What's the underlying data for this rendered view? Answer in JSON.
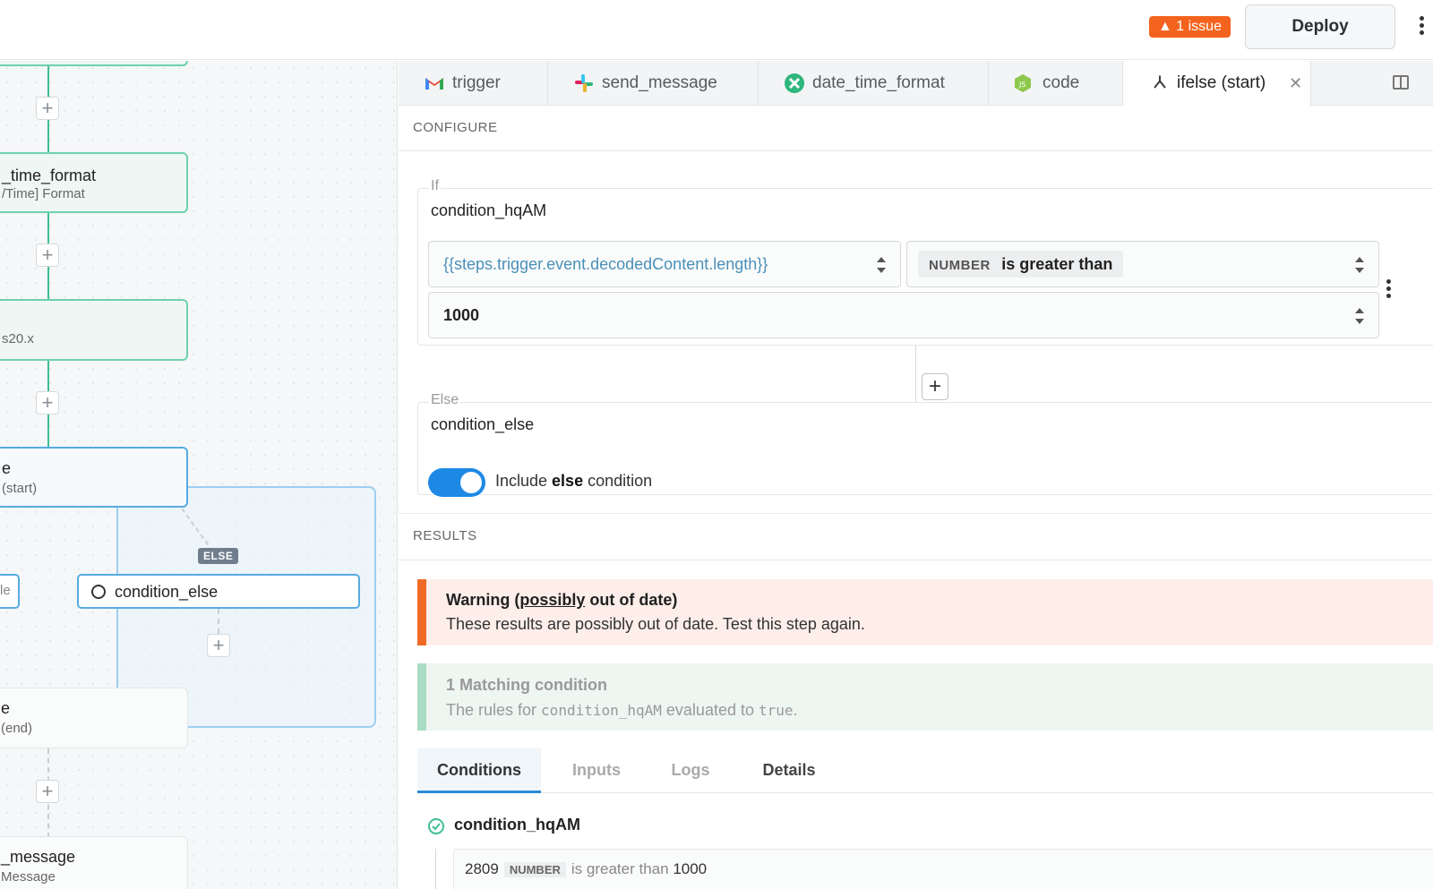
{
  "header": {
    "issue_badge": "▲ 1 issue",
    "deploy_label": "Deploy"
  },
  "canvas": {
    "node_date_time_format": {
      "title": "_time_format",
      "subtitle": "/Time] Format"
    },
    "node_code": {
      "subtitle": "s20.x"
    },
    "node_ifelse_start": {
      "title": "e",
      "subtitle": "(start)"
    },
    "else_tag": "ELSE",
    "node_if_partial": "le",
    "node_condition_else": "condition_else",
    "node_ifelse_end": {
      "title": "e",
      "subtitle": "(end)"
    },
    "node_send_message": {
      "title": "_message",
      "subtitle": "Message"
    }
  },
  "tabs": [
    {
      "label": "trigger",
      "icon": "gmail-icon"
    },
    {
      "label": "send_message",
      "icon": "slack-icon"
    },
    {
      "label": "date_time_format",
      "icon": "tools-icon"
    },
    {
      "label": "code",
      "icon": "nodejs-icon"
    },
    {
      "label": "ifelse (start)",
      "icon": "branch-icon",
      "active": true
    }
  ],
  "configure": {
    "section_label": "CONFIGURE",
    "if_legend": "If",
    "if_condition_name": "condition_hqAM",
    "lhs_value": "{{steps.trigger.event.decodedContent.length}}",
    "operator_type": "NUMBER",
    "operator_label": "is greater than",
    "rhs_value": "1000",
    "else_legend": "Else",
    "else_condition_name": "condition_else",
    "toggle_prefix": "Include ",
    "toggle_bold": "else",
    "toggle_suffix": " condition",
    "toggle_on": true
  },
  "results": {
    "section_label": "RESULTS",
    "warning_title_prefix": "Warning (",
    "warning_title_underlined": "possibly",
    "warning_title_suffix": " out of date)",
    "warning_body": "These results are possibly out of date. Test this step again.",
    "match_title": "1 Matching condition",
    "match_prefix": "The rules for ",
    "match_code": "condition_hqAM",
    "match_middle": " evaluated to ",
    "match_value": "true",
    "match_suffix": ".",
    "tabs": [
      "Conditions",
      "Inputs",
      "Logs",
      "Details"
    ],
    "result_name": "condition_hqAM",
    "result_lhs": "2809",
    "result_type": "NUMBER",
    "result_op": "is greater than",
    "result_rhs": "1000"
  },
  "colors": {
    "accent": "#1e88e5",
    "warning": "#f06a27",
    "success": "#3fbf92",
    "link_blue": "#4a90b8"
  }
}
